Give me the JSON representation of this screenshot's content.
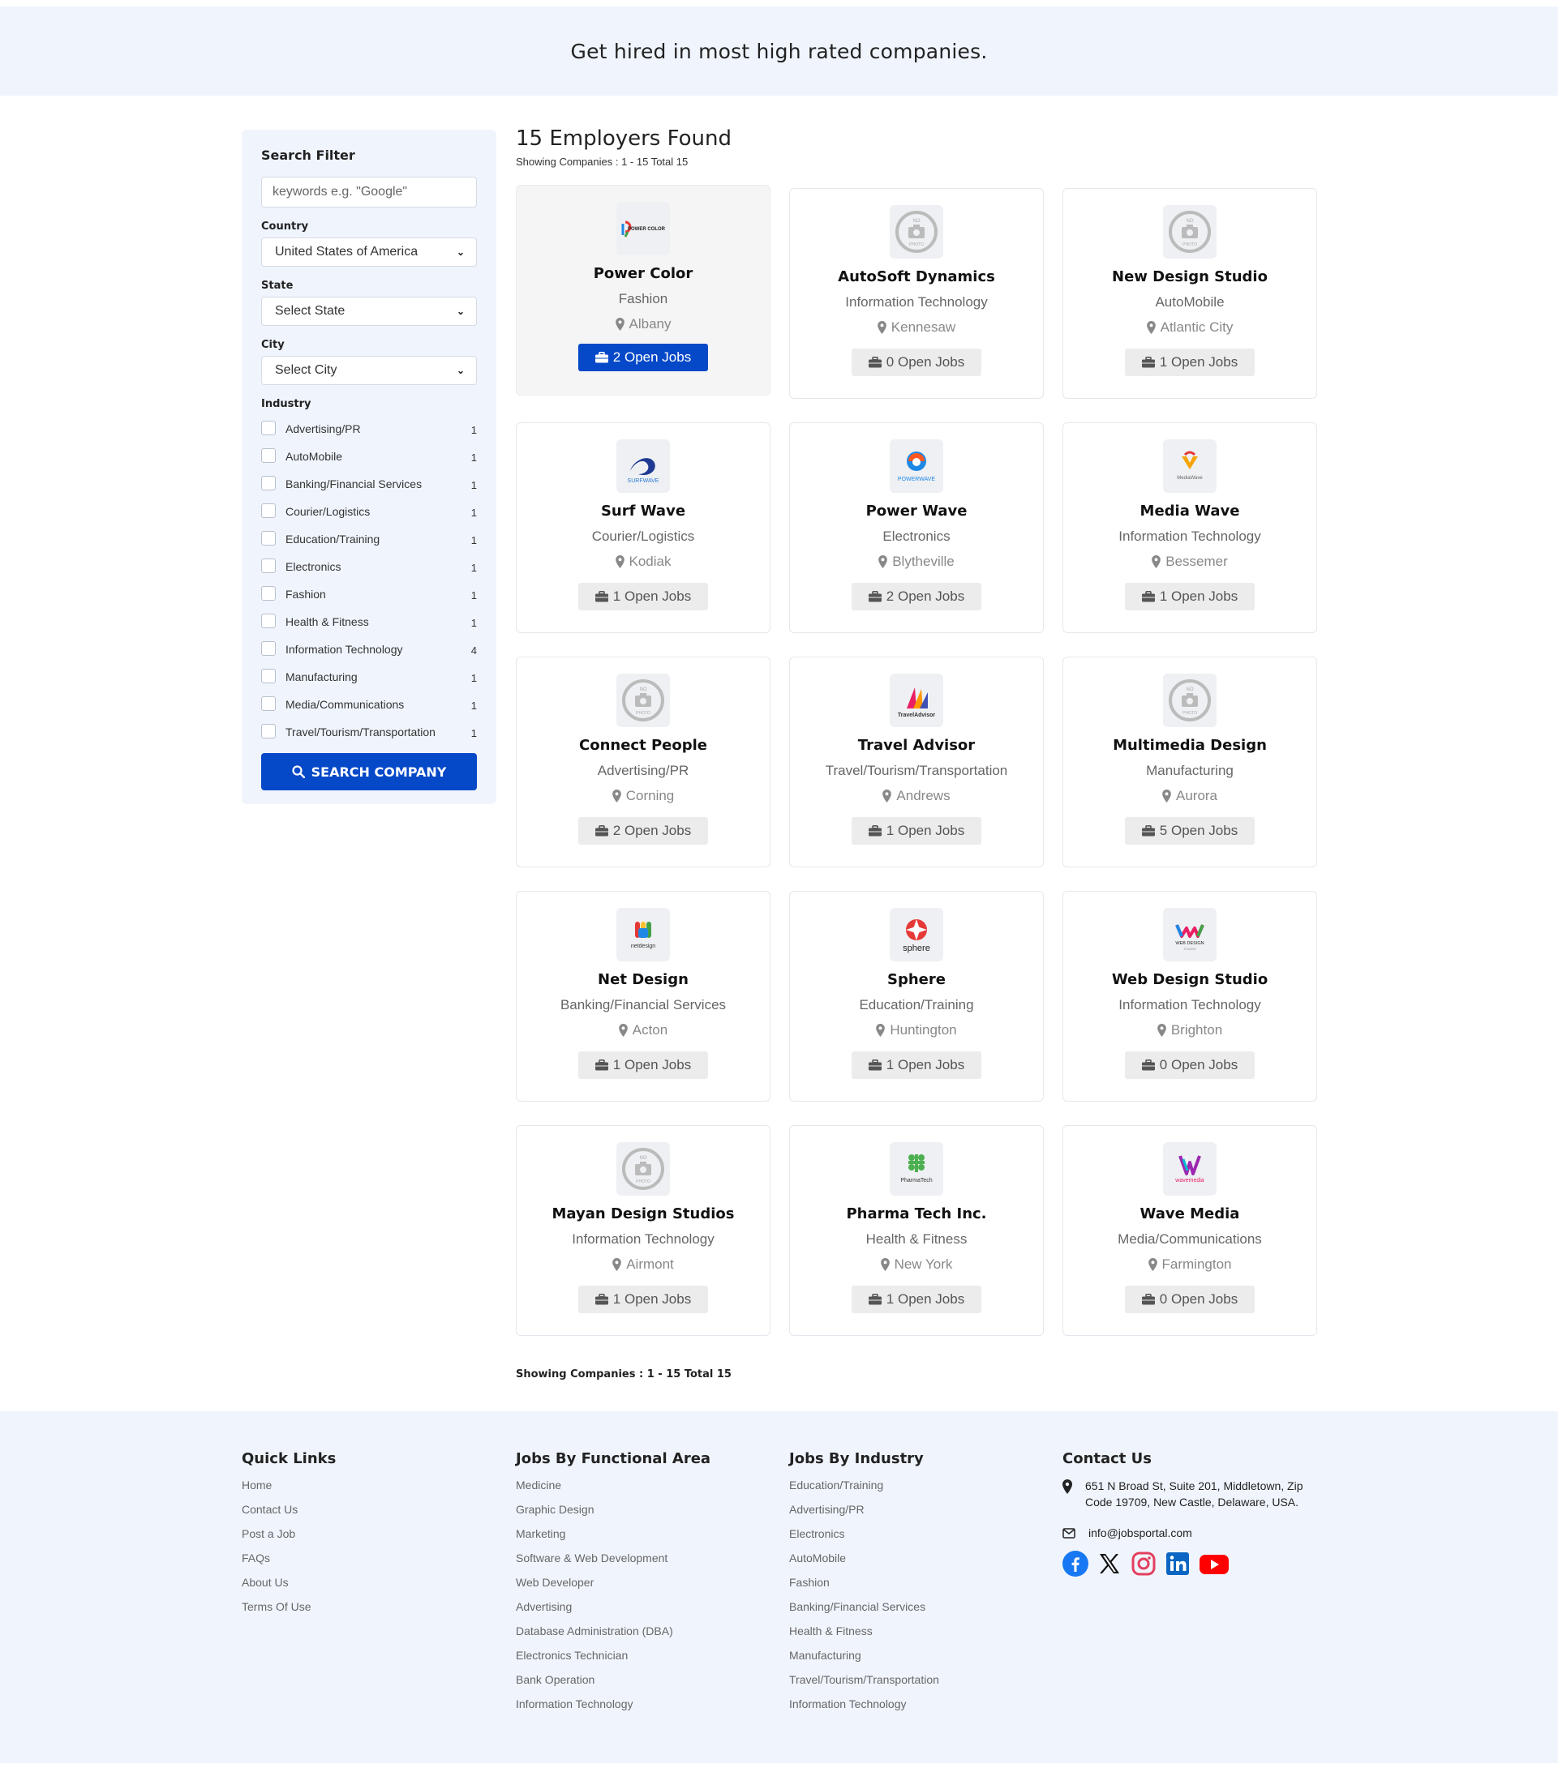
{
  "hero": {
    "title": "Get hired in most high rated companies."
  },
  "filter": {
    "title": "Search Filter",
    "keyword_placeholder": "keywords e.g. \"Google\"",
    "country_label": "Country",
    "country_value": "United States of America",
    "state_label": "State",
    "state_value": "Select State",
    "city_label": "City",
    "city_value": "Select City",
    "industry_label": "Industry",
    "industries": [
      {
        "label": "Advertising/PR",
        "count": "1"
      },
      {
        "label": "AutoMobile",
        "count": "1"
      },
      {
        "label": "Banking/Financial Services",
        "count": "1"
      },
      {
        "label": "Courier/Logistics",
        "count": "1"
      },
      {
        "label": "Education/Training",
        "count": "1"
      },
      {
        "label": "Electronics",
        "count": "1"
      },
      {
        "label": "Fashion",
        "count": "1"
      },
      {
        "label": "Health & Fitness",
        "count": "1"
      },
      {
        "label": "Information Technology",
        "count": "4"
      },
      {
        "label": "Manufacturing",
        "count": "1"
      },
      {
        "label": "Media/Communications",
        "count": "1"
      },
      {
        "label": "Travel/Tourism/Transportation",
        "count": "1"
      }
    ],
    "search_button": "SEARCH COMPANY"
  },
  "results": {
    "title": "15 Employers Found",
    "subtitle": "Showing Companies : 1 - 15 Total 15",
    "footer_note": "Showing Companies : 1 - 15 Total 15"
  },
  "companies": [
    {
      "name": "Power Color",
      "industry": "Fashion",
      "location": "Albany",
      "jobs": "2 Open Jobs",
      "logo": "powercolor-logo"
    },
    {
      "name": "AutoSoft Dynamics",
      "industry": "Information Technology",
      "location": "Kennesaw",
      "jobs": "0 Open Jobs",
      "logo": "no-photo-icon"
    },
    {
      "name": "New Design Studio",
      "industry": "AutoMobile",
      "location": "Atlantic City",
      "jobs": "1 Open Jobs",
      "logo": "no-photo-icon"
    },
    {
      "name": "Surf Wave",
      "industry": "Courier/Logistics",
      "location": "Kodiak",
      "jobs": "1 Open Jobs",
      "logo": "surfwave-logo"
    },
    {
      "name": "Power Wave",
      "industry": "Electronics",
      "location": "Blytheville",
      "jobs": "2 Open Jobs",
      "logo": "powerwave-logo"
    },
    {
      "name": "Media Wave",
      "industry": "Information Technology",
      "location": "Bessemer",
      "jobs": "1 Open Jobs",
      "logo": "mediawave-logo"
    },
    {
      "name": "Connect People",
      "industry": "Advertising/PR",
      "location": "Corning",
      "jobs": "2 Open Jobs",
      "logo": "no-photo-icon"
    },
    {
      "name": "Travel Advisor",
      "industry": "Travel/Tourism/Transportation",
      "location": "Andrews",
      "jobs": "1 Open Jobs",
      "logo": "traveladvisor-logo"
    },
    {
      "name": "Multimedia Design",
      "industry": "Manufacturing",
      "location": "Aurora",
      "jobs": "5 Open Jobs",
      "logo": "no-photo-icon"
    },
    {
      "name": "Net Design",
      "industry": "Banking/Financial Services",
      "location": "Acton",
      "jobs": "1 Open Jobs",
      "logo": "netdesign-logo"
    },
    {
      "name": "Sphere",
      "industry": "Education/Training",
      "location": "Huntington",
      "jobs": "1 Open Jobs",
      "logo": "sphere-logo"
    },
    {
      "name": "Web Design Studio",
      "industry": "Information Technology",
      "location": "Brighton",
      "jobs": "0 Open Jobs",
      "logo": "webdesign-logo"
    },
    {
      "name": "Mayan Design Studios",
      "industry": "Information Technology",
      "location": "Airmont",
      "jobs": "1 Open Jobs",
      "logo": "no-photo-icon"
    },
    {
      "name": "Pharma Tech Inc.",
      "industry": "Health & Fitness",
      "location": "New York",
      "jobs": "1 Open Jobs",
      "logo": "pharmatech-logo"
    },
    {
      "name": "Wave Media",
      "industry": "Media/Communications",
      "location": "Farmington",
      "jobs": "0 Open Jobs",
      "logo": "wavemedia-logo"
    }
  ],
  "logo_text": {
    "powercolor": "POWER COLOR",
    "no_photo_top": "NO",
    "no_photo_bottom": "PHOTO",
    "surfwave": "SURFWAVE",
    "powerwave": "POWERWAVE",
    "mediawave": "MediaWave",
    "traveladvisor": "TravelAdvisor",
    "netdesign": "netdesign",
    "sphere": "sphere",
    "webdesign": "WEB DESIGN",
    "webdesign_sub": "STUDIO",
    "pharmatech": "PharmaTech",
    "wavemedia": "wavemedia"
  },
  "footer": {
    "quick_links_title": "Quick Links",
    "quick_links": [
      "Home",
      "Contact Us",
      "Post a Job",
      "FAQs",
      "About Us",
      "Terms Of Use"
    ],
    "functional_title": "Jobs By Functional Area",
    "functional": [
      "Medicine",
      "Graphic Design",
      "Marketing",
      "Software & Web Development",
      "Web Developer",
      "Advertising",
      "Database Administration (DBA)",
      "Electronics Technician",
      "Bank Operation",
      "Information Technology"
    ],
    "industry_title": "Jobs By Industry",
    "industry": [
      "Education/Training",
      "Advertising/PR",
      "Electronics",
      "AutoMobile",
      "Fashion",
      "Banking/Financial Services",
      "Health & Fitness",
      "Manufacturing",
      "Travel/Tourism/Transportation",
      "Information Technology"
    ],
    "contact_title": "Contact Us",
    "address": "651 N Broad St, Suite 201, Middletown, Zip Code 19709, New Castle, Delaware, USA.",
    "email": "info@jobsportal.com"
  },
  "colors": {
    "primary": "#0548c8",
    "panel": "#f0f5fd",
    "facebook": "#1877f2",
    "instagram": "#e4405f",
    "linkedin": "#0a66c2",
    "youtube": "#ff0000"
  }
}
